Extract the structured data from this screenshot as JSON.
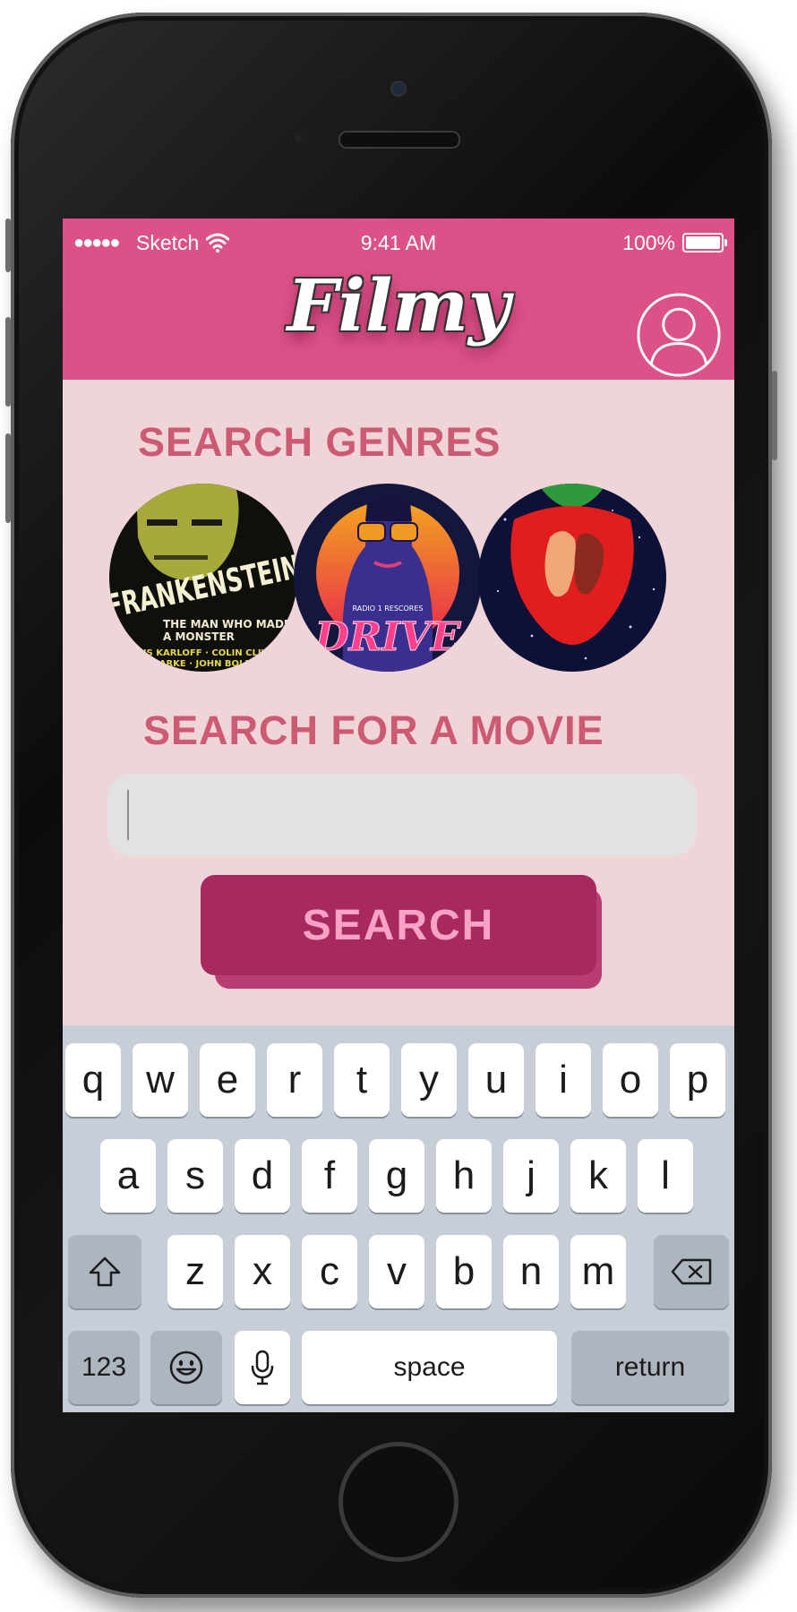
{
  "status_bar": {
    "signal_dots": "●●●●●",
    "carrier": "Sketch",
    "time": "9:41 AM",
    "battery": "100%"
  },
  "header": {
    "logo": "Filmy",
    "profile_icon": "user-icon"
  },
  "genres": {
    "title": "SEARCH GENRES",
    "items": [
      {
        "poster_text": "FRANKENSTEIN",
        "poster_subtext": "THE MAN WHO MADE A MONSTER",
        "credits": "BORIS KARLOFF · COLIN CLIVE · MAE CLARKE · JOHN BOLES"
      },
      {
        "poster_text": "DRIVE",
        "poster_subtext": "RADIO 1 RESCORES"
      },
      {
        "poster_text": ""
      }
    ]
  },
  "movie_search": {
    "title": "SEARCH FOR A MOVIE",
    "value": "",
    "placeholder": "",
    "button_label": "SEARCH"
  },
  "keyboard": {
    "row1": [
      "q",
      "w",
      "e",
      "r",
      "t",
      "y",
      "u",
      "i",
      "o",
      "p"
    ],
    "row2": [
      "a",
      "s",
      "d",
      "f",
      "g",
      "h",
      "j",
      "k",
      "l"
    ],
    "row3": [
      "z",
      "x",
      "c",
      "v",
      "b",
      "n",
      "m"
    ],
    "numbers_label": "123",
    "space_label": "space",
    "return_label": "return",
    "icons": {
      "shift": "shift-icon",
      "backspace": "backspace-icon",
      "emoji": "emoji-icon",
      "mic": "microphone-icon"
    }
  },
  "colors": {
    "header": "#dc5188",
    "background": "#efd4d8",
    "title": "#cc5a72",
    "button": "#a8295e",
    "button_text": "#f8a3c5",
    "keyboard": "#c7ced8"
  }
}
